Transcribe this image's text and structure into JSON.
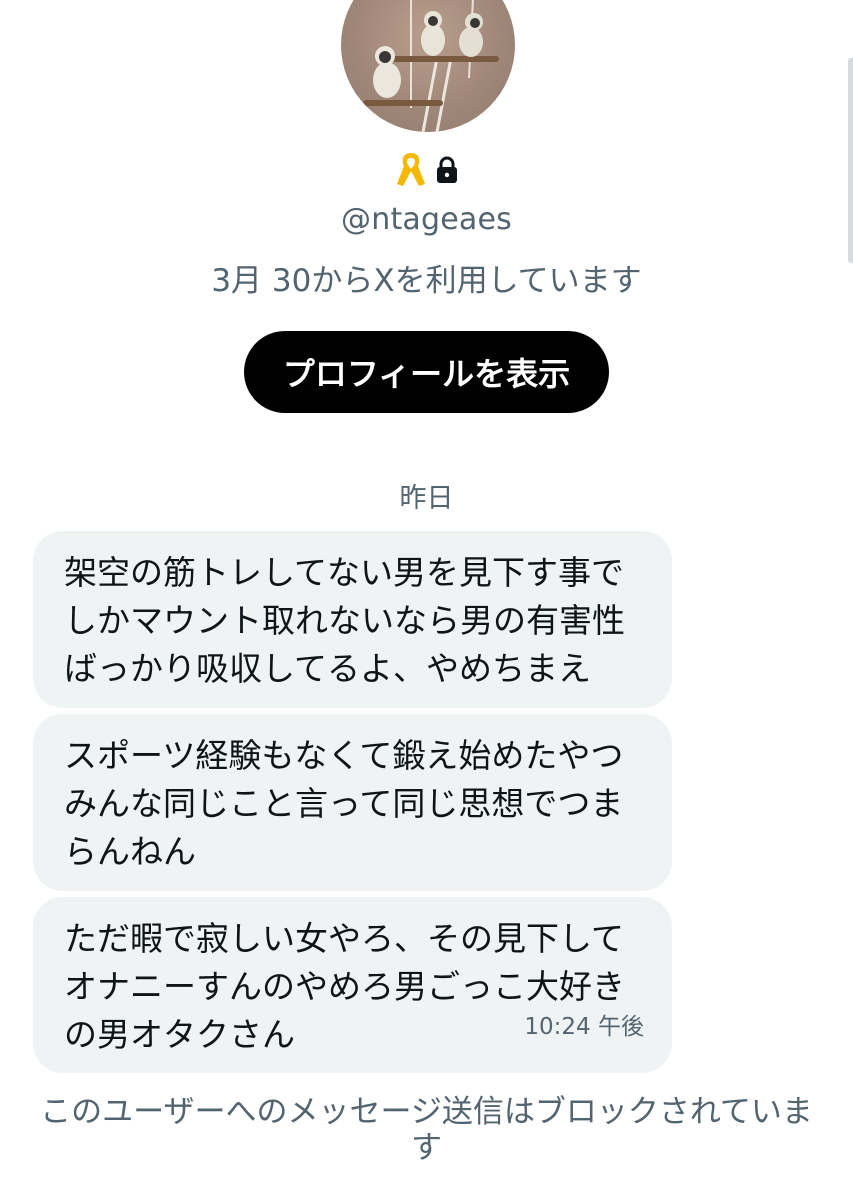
{
  "profile": {
    "handle": "@ntageaes",
    "joined_text": "3月 30からXを利用しています",
    "view_profile_label": "プロフィールを表示",
    "badge_icons": [
      "yellow-ribbon",
      "lock"
    ],
    "avatar_description_icon": "monkeys-avatar"
  },
  "conversation": {
    "date_separator": "昨日",
    "messages": [
      {
        "lines": [
          "架空の筋トレしてない男を見下す事で",
          "しかマウント取れないなら男の有害性",
          "ばっかり吸収してるよ、やめちまえ"
        ]
      },
      {
        "lines": [
          "スポーツ経験もなくて鍛え始めたやつ",
          "みんな同じこと言って同じ思想でつま",
          "らんねん"
        ]
      },
      {
        "lines": [
          "ただ暇で寂しい女やろ、その見下して",
          "オナニーすんのやめろ男ごっこ大好き",
          "の男オタクさん"
        ],
        "time": "10:24 午後"
      }
    ],
    "blocked_notice_lines": [
      "このユーザーへのメッセージ送信はブロックされていま",
      "す"
    ]
  },
  "colors": {
    "secondary_text": "#536471",
    "bubble_bg": "#eff3f4",
    "button_bg": "#000000",
    "ribbon": "#f5b800"
  }
}
